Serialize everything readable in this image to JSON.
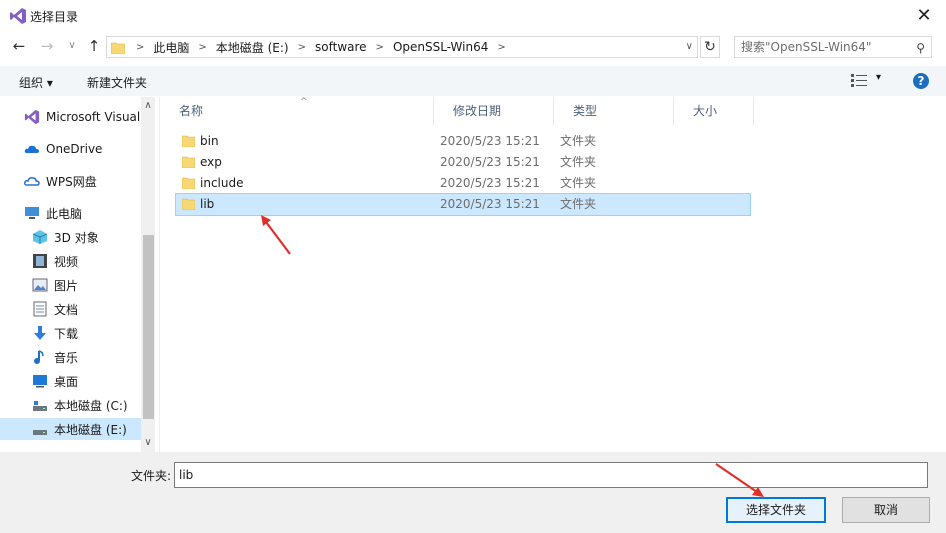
{
  "window": {
    "title": "选择目录",
    "close_glyph": "✕",
    "app_icon": "visual-studio-icon"
  },
  "nav": {
    "back": "←",
    "forward": "→",
    "recent": "∨",
    "up": "↑"
  },
  "address": {
    "crumbs": [
      "此电脑",
      "本地磁盘 (E:)",
      "software",
      "OpenSSL-Win64"
    ],
    "separator": ">",
    "dropdown": "∨",
    "refresh": "↻"
  },
  "search": {
    "placeholder": "搜索\"OpenSSL-Win64\"",
    "icon": "⚲"
  },
  "toolbar": {
    "organize": "组织 ▾",
    "new_folder": "新建文件夹",
    "view_dropdown": "▾",
    "help": "?"
  },
  "sidebar": {
    "items": [
      {
        "label": "Microsoft Visual",
        "icon": "visual-studio-icon"
      },
      {
        "label": "OneDrive",
        "icon": "cloud-icon"
      },
      {
        "label": "WPS网盘",
        "icon": "wps-cloud-icon"
      },
      {
        "label": "此电脑",
        "icon": "computer-icon"
      },
      {
        "label": "3D 对象",
        "icon": "cube-icon"
      },
      {
        "label": "视频",
        "icon": "video-icon"
      },
      {
        "label": "图片",
        "icon": "picture-icon"
      },
      {
        "label": "文档",
        "icon": "document-icon"
      },
      {
        "label": "下载",
        "icon": "download-icon"
      },
      {
        "label": "音乐",
        "icon": "music-icon"
      },
      {
        "label": "桌面",
        "icon": "desktop-icon"
      },
      {
        "label": "本地磁盘 (C:)",
        "icon": "drive-icon"
      },
      {
        "label": "本地磁盘 (E:)",
        "icon": "drive-icon",
        "selected": true
      }
    ],
    "scroll_up": "∧",
    "scroll_down": "∨"
  },
  "list": {
    "columns": [
      "名称",
      "修改日期",
      "类型",
      "大小"
    ],
    "sort_indicator": "^",
    "rows": [
      {
        "name": "bin",
        "date": "2020/5/23 15:21",
        "type": "文件夹"
      },
      {
        "name": "exp",
        "date": "2020/5/23 15:21",
        "type": "文件夹"
      },
      {
        "name": "include",
        "date": "2020/5/23 15:21",
        "type": "文件夹"
      },
      {
        "name": "lib",
        "date": "2020/5/23 15:21",
        "type": "文件夹",
        "selected": true
      }
    ]
  },
  "footer": {
    "folder_label": "文件夹:",
    "folder_value": "lib",
    "ok_label": "选择文件夹",
    "cancel_label": "取消"
  },
  "colors": {
    "accent": "#0078d7",
    "selection": "#cce8ff",
    "annotation": "#e0302a",
    "folder": "#f8d775"
  }
}
